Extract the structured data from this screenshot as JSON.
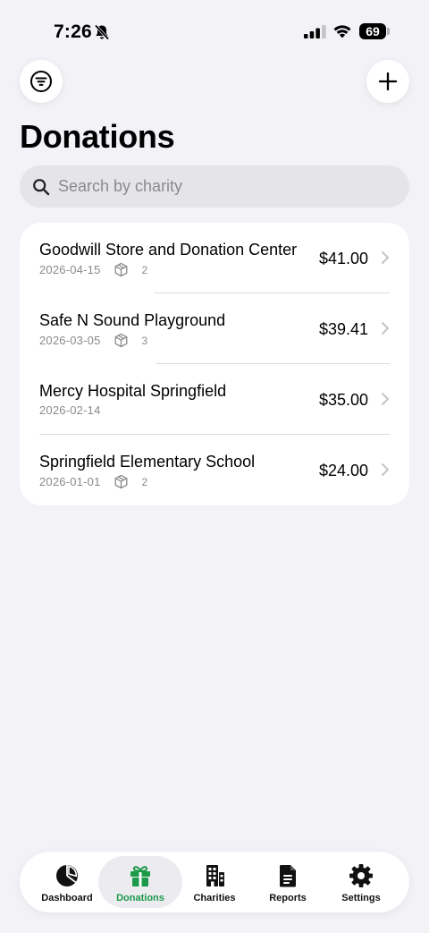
{
  "status_bar": {
    "time": "7:26",
    "battery": "69"
  },
  "header": {
    "title": "Donations"
  },
  "search": {
    "placeholder": "Search by charity",
    "value": ""
  },
  "donations": [
    {
      "charity": "Goodwill Store and Donation Center",
      "date": "2026-04-15",
      "items": "2",
      "amount": "$41.00"
    },
    {
      "charity": "Safe N Sound Playground",
      "date": "2026-03-05",
      "items": "3",
      "amount": "$39.41"
    },
    {
      "charity": "Mercy Hospital Springfield",
      "date": "2026-02-14",
      "items": "",
      "amount": "$35.00"
    },
    {
      "charity": "Springfield Elementary School",
      "date": "2026-01-01",
      "items": "2",
      "amount": "$24.00"
    }
  ],
  "tabs": [
    {
      "label": "Dashboard",
      "icon": "pie-chart-icon"
    },
    {
      "label": "Donations",
      "icon": "gift-icon"
    },
    {
      "label": "Charities",
      "icon": "building-icon"
    },
    {
      "label": "Reports",
      "icon": "document-icon"
    },
    {
      "label": "Settings",
      "icon": "gear-icon"
    }
  ],
  "colors": {
    "accent": "#1b9a4a",
    "background": "#f2f2f7",
    "secondary_text": "#8a8a8e"
  }
}
